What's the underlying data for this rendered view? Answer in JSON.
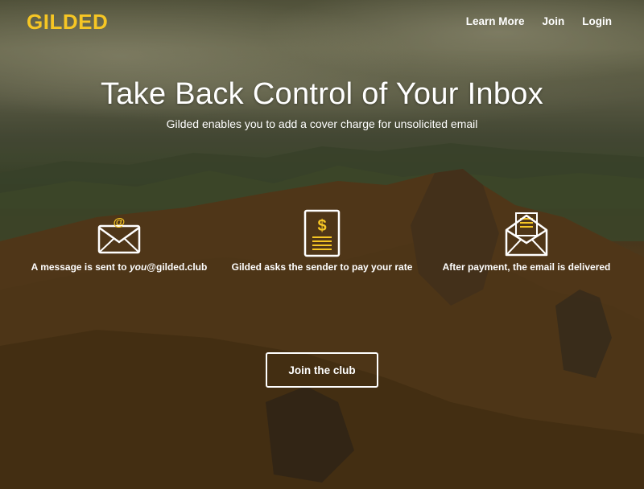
{
  "brand": {
    "logo_text": "GILDED",
    "accent_color": "#f6c624"
  },
  "nav": {
    "items": [
      {
        "label": "Learn More"
      },
      {
        "label": "Join"
      },
      {
        "label": "Login"
      }
    ]
  },
  "hero": {
    "title": "Take Back Control of Your Inbox",
    "subtitle": "Gilded enables you to add a cover charge for unsolicited email"
  },
  "steps": [
    {
      "icon": "envelope-at-icon",
      "label_prefix": "A message is sent to ",
      "label_emphasis": "you",
      "label_suffix": "@gilded.club"
    },
    {
      "icon": "invoice-dollar-icon",
      "label": "Gilded asks the sender to pay your rate"
    },
    {
      "icon": "open-envelope-letter-icon",
      "label": "After payment, the email is delivered"
    }
  ],
  "cta": {
    "label": "Join the club"
  }
}
